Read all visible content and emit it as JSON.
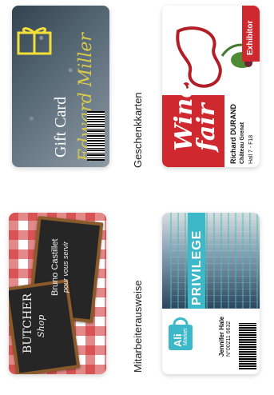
{
  "gift_card": {
    "title": "Gift Card",
    "name": "Edward Miller",
    "icon": "gift-ribbon-icon",
    "colors": {
      "accent": "#d8c84c",
      "base": "#32424f"
    }
  },
  "wine_card": {
    "wordmark_line1": "Wine",
    "wordmark_line2": "fair",
    "badge": "Exhibitor",
    "person_name": "Richard DURAND",
    "company": "Château Grenat",
    "location": "Hall 7 - F18",
    "colors": {
      "accent": "#d0282f"
    }
  },
  "butcher_card": {
    "shop_line1": "BUTCHER",
    "shop_line2": "Shop",
    "person": "Bruno Castillet",
    "tagline": "pour vous servir",
    "colors": {
      "check": "#cd2828",
      "board": "#262626",
      "frame": "#8a5a2b"
    }
  },
  "privilege_card": {
    "title": "PRIVILEGE",
    "brand_line1": "Ali",
    "brand_line2": "Market",
    "holder": "Jennifer Hale",
    "number": "N°00211 6632",
    "colors": {
      "band": "#3db8c8"
    }
  },
  "labels": {
    "gift": "Geschenkkarten",
    "staff": "Mitarbeiterausweise"
  }
}
